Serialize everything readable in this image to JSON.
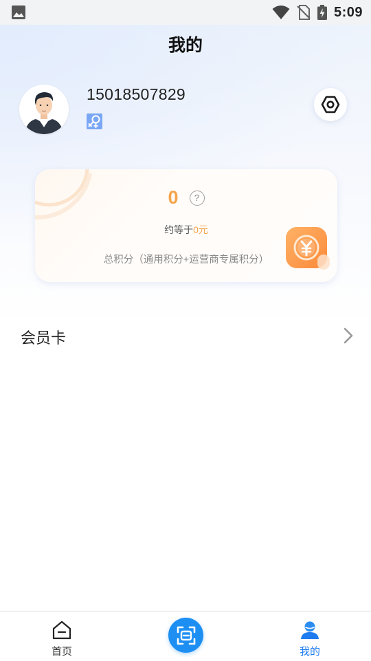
{
  "status_bar": {
    "time": "5:09",
    "icons": [
      "gallery-icon",
      "wifi-icon",
      "no-sim-icon",
      "battery-charging-icon"
    ]
  },
  "header": {
    "title": "我的"
  },
  "profile": {
    "phone": "15018507829",
    "gender_icon": "female-male-icon",
    "settings_icon": "settings-icon"
  },
  "points_card": {
    "points": "0",
    "help_icon": "question-icon",
    "help_glyph": "?",
    "approx_prefix": "约等于",
    "approx_value": "0元",
    "total_label": "总积分（通用积分+运营商专属积分）",
    "coin_icon": "yuan-coin-icon",
    "accent_color": "#f5a44a"
  },
  "menu": {
    "member_card_label": "会员卡",
    "chevron_icon": "chevron-right-icon"
  },
  "tab_bar": {
    "tabs": [
      {
        "label": "首页",
        "icon": "home-icon",
        "active": false
      },
      {
        "label": "我的",
        "icon": "user-icon",
        "active": true
      }
    ],
    "scan_icon": "scan-icon",
    "active_color": "#1e7cf0"
  }
}
